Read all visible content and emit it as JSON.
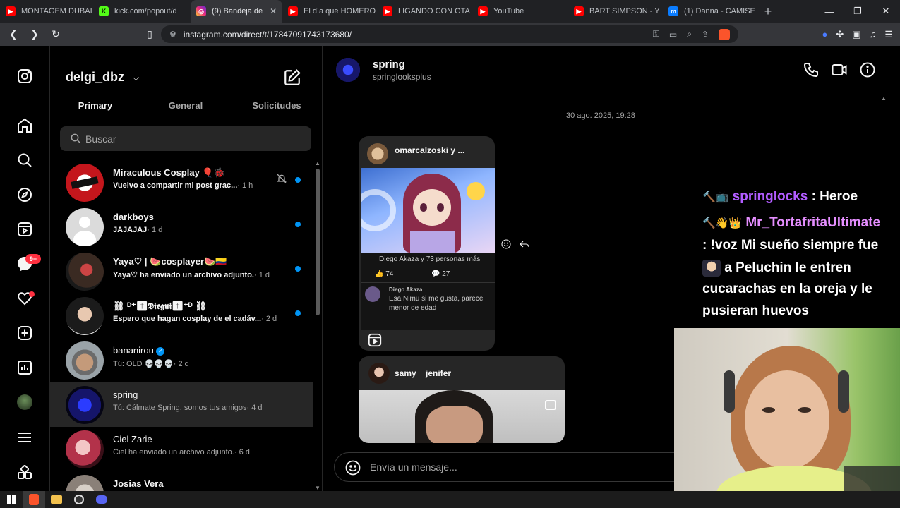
{
  "browser": {
    "tabs": [
      {
        "title": "MONTAGEM DUBAI",
        "icon": "youtube-icon",
        "active": false
      },
      {
        "title": "kick.com/popout/d",
        "icon": "kick-icon",
        "active": false
      },
      {
        "title": "(9) Bandeja de",
        "icon": "instagram-icon",
        "active": true
      },
      {
        "title": "El día que HOMERO",
        "icon": "youtube-icon",
        "active": false
      },
      {
        "title": "LIGANDO CON OTA",
        "icon": "youtube-icon",
        "active": false
      },
      {
        "title": "YouTube",
        "icon": "youtube-icon",
        "active": false
      },
      {
        "title": "BART SIMPSON - Y",
        "icon": "youtube-icon",
        "active": false
      },
      {
        "title": "(1) Danna - CAMISE",
        "icon": "messenger-icon",
        "active": false
      }
    ],
    "url": "instagram.com/direct/t/17847091743173680/"
  },
  "rail": {
    "notifications_badge": "9+"
  },
  "inbox": {
    "account": "delgi_dbz",
    "tabs": [
      "Primary",
      "General",
      "Solicitudes"
    ],
    "search_placeholder": "Buscar",
    "threads": [
      {
        "name": "Miraculous Cosplay 🎈🐞",
        "preview": "Vuelvo a compartir mi post grac...",
        "time": "· 1 h",
        "unread": true,
        "muted": true,
        "bold": true
      },
      {
        "name": "darkboys",
        "preview": "JAJAJAJ",
        "time": "· 1 d",
        "unread": true,
        "muted": false,
        "bold": true
      },
      {
        "name": "Yaya♡ | 🍉cosplayer🍉🇨🇴",
        "preview": "Yaya♡ ha enviado un archivo adjunto.",
        "time": "· 1 d",
        "unread": true,
        "muted": false,
        "bold": true
      },
      {
        "name": "⛓ ᴰ⁺✝𝕯𝖎𝖊𝖌𝖚𝖎✝⁺ᴰ ⛓",
        "preview": "Espero que hagan cosplay de el cadáv...",
        "time": "· 2 d",
        "unread": true,
        "muted": false,
        "bold": true
      },
      {
        "name": "bananirou",
        "preview": "Tú: OLD 💀💀💀",
        "time": "· 2 d",
        "unread": false,
        "muted": false,
        "bold": false,
        "verified": true
      },
      {
        "name": "spring",
        "preview": "Tú: Cálmate Spring, somos tus amigos",
        "time": "· 4 d",
        "unread": false,
        "muted": false,
        "bold": false,
        "selected": true
      },
      {
        "name": "Ciel Zarie",
        "preview": "Ciel ha enviado un archivo adjunto.",
        "time": "· 6 d",
        "unread": false,
        "muted": false,
        "bold": false
      },
      {
        "name": "Josias Vera",
        "preview": "",
        "time": "",
        "unread": false,
        "muted": false,
        "bold": false
      }
    ]
  },
  "chat": {
    "name": "spring",
    "username": "springlooksplus",
    "timestamp": "30 ago. 2025, 19:28",
    "post1": {
      "user": "omarcalzoski y ...",
      "likes_line": "Diego Akaza y 73 personas más",
      "likes": "74",
      "comments": "27",
      "comment_user": "Diego Akaza",
      "comment_line1": "Esa Nimu si me gusta, parece",
      "comment_line2": "menor de edad"
    },
    "post2": {
      "user": "samy__jenifer"
    },
    "composer_placeholder": "Envía un mensaje..."
  },
  "overlay_chat": {
    "line0_user": "springlocks",
    "line0_text": ": Heroe",
    "line1_user": "Mr_TortafritaUltimate",
    "line2": ": !voz Mi sueño siempre fue",
    "line3": "a Peluchin le entren",
    "line4": "cucarachas en la oreja y le",
    "line5": "pusieran huevos"
  }
}
